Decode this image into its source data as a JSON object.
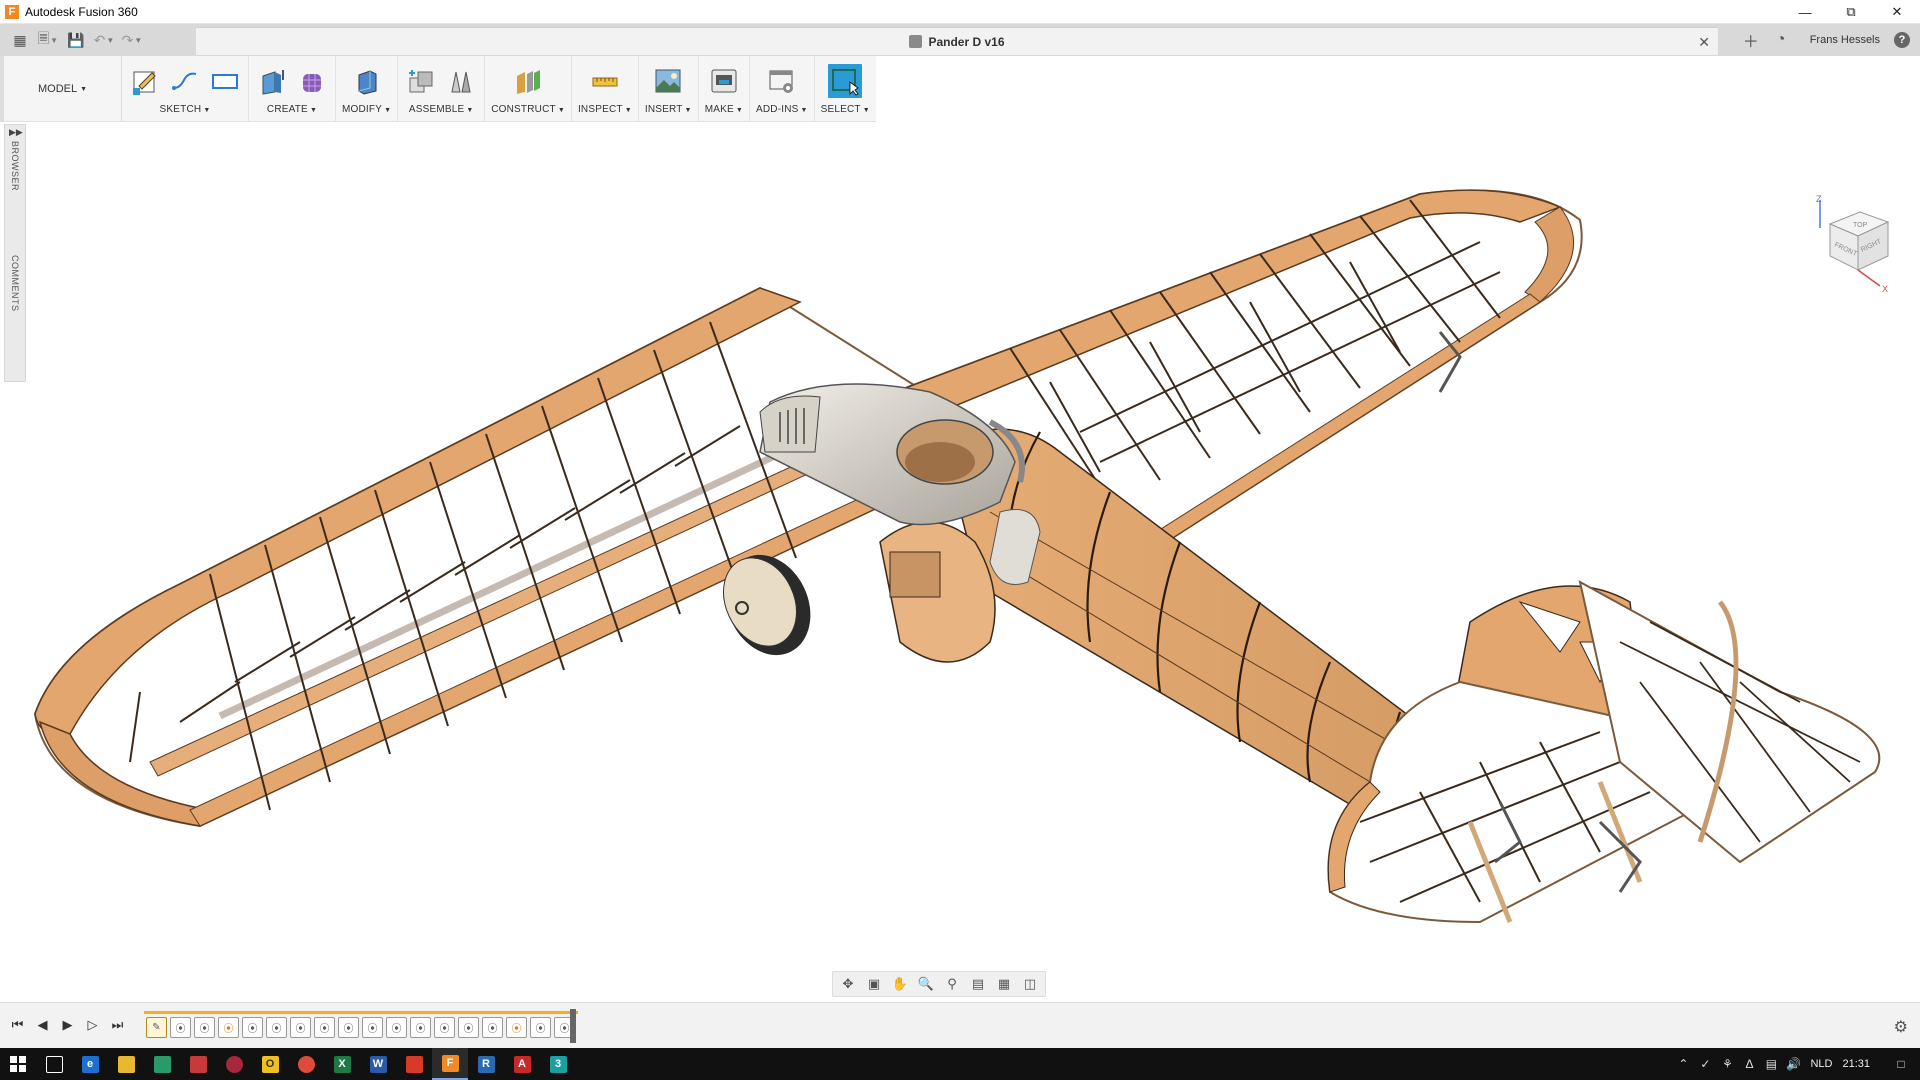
{
  "window": {
    "app_title": "Autodesk Fusion 360",
    "app_logo_letter": "F",
    "controls": [
      "minimize-icon",
      "restore-icon",
      "close-icon"
    ]
  },
  "tabbar": {
    "document_title": "Pander D v16",
    "user_name": "Frans Hessels",
    "help_label": "?"
  },
  "toolbar": {
    "workspace_label": "MODEL",
    "groups": [
      {
        "label": "SKETCH"
      },
      {
        "label": "CREATE"
      },
      {
        "label": "MODIFY"
      },
      {
        "label": "ASSEMBLE"
      },
      {
        "label": "CONSTRUCT"
      },
      {
        "label": "INSPECT"
      },
      {
        "label": "INSERT"
      },
      {
        "label": "MAKE"
      },
      {
        "label": "ADD-INS"
      },
      {
        "label": "SELECT"
      }
    ]
  },
  "browser_strip": {
    "browser_label": "BROWSER",
    "comments_label": "COMMENTS"
  },
  "viewcube": {
    "top": "TOP",
    "front": "FRONT",
    "right": "RIGHT",
    "axis_z": "Z",
    "axis_x": "X"
  },
  "timeline": {
    "feature_count": 18
  },
  "taskbar": {
    "language": "NLD",
    "clock": "21:31"
  },
  "colors": {
    "wood": "#e3a66f",
    "wood_dark": "#c98b52",
    "structure_line": "#3a2a1c",
    "metal": "#cfcac0",
    "accent": "#2b9bd6"
  }
}
